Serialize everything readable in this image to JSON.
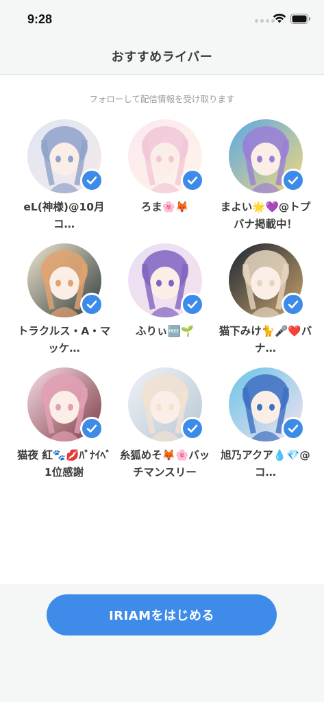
{
  "status_bar": {
    "time": "9:28"
  },
  "header": {
    "title": "おすすめライバー"
  },
  "subtitle": "フォローして配信情報を受け取ります",
  "livers": [
    {
      "name": "eL(神様)@10月コ…",
      "selected": true,
      "palette": [
        "#dfe6f3",
        "#8fa2c9",
        "#f4e9ea"
      ]
    },
    {
      "name": "ろま🌸🦊",
      "selected": true,
      "palette": [
        "#fbe9f0",
        "#f1c7d8",
        "#fff3e8"
      ]
    },
    {
      "name": "まよい🌟💜@トプバナ掲載中！",
      "selected": true,
      "palette": [
        "#5aa7e6",
        "#9a7fd6",
        "#f3d97a"
      ]
    },
    {
      "name": "トラクルス・A・マッケ…",
      "selected": true,
      "palette": [
        "#efe6cf",
        "#e2a36f",
        "#2f3a3a"
      ]
    },
    {
      "name": "ふりぃ🆓🌱",
      "selected": true,
      "palette": [
        "#e8dff4",
        "#8064c2",
        "#f6e1ec"
      ]
    },
    {
      "name": "猫下みけ🐈🎤❤️バナ…",
      "selected": true,
      "palette": [
        "#1c2433",
        "#e6d6bf",
        "#c9a46c"
      ]
    },
    {
      "name": "猫夜 紅🐾💋ﾊﾞﾅｲﾍﾞ1位感謝",
      "selected": true,
      "palette": [
        "#f6dde6",
        "#e2a0b4",
        "#7b3a44"
      ]
    },
    {
      "name": "糸狐めそ🦊🌸バッチマンスリー",
      "selected": true,
      "palette": [
        "#eef2f6",
        "#f2e2d0",
        "#b9c7d6"
      ]
    },
    {
      "name": "旭乃アクア💧💎@コ…",
      "selected": true,
      "palette": [
        "#6bc4e8",
        "#3f6fc2",
        "#f4e2ef"
      ]
    }
  ],
  "footer": {
    "start_button_label": "IRIAMをはじめる"
  },
  "colors": {
    "accent": "#3e8be9",
    "background": "#f5f6f6"
  }
}
